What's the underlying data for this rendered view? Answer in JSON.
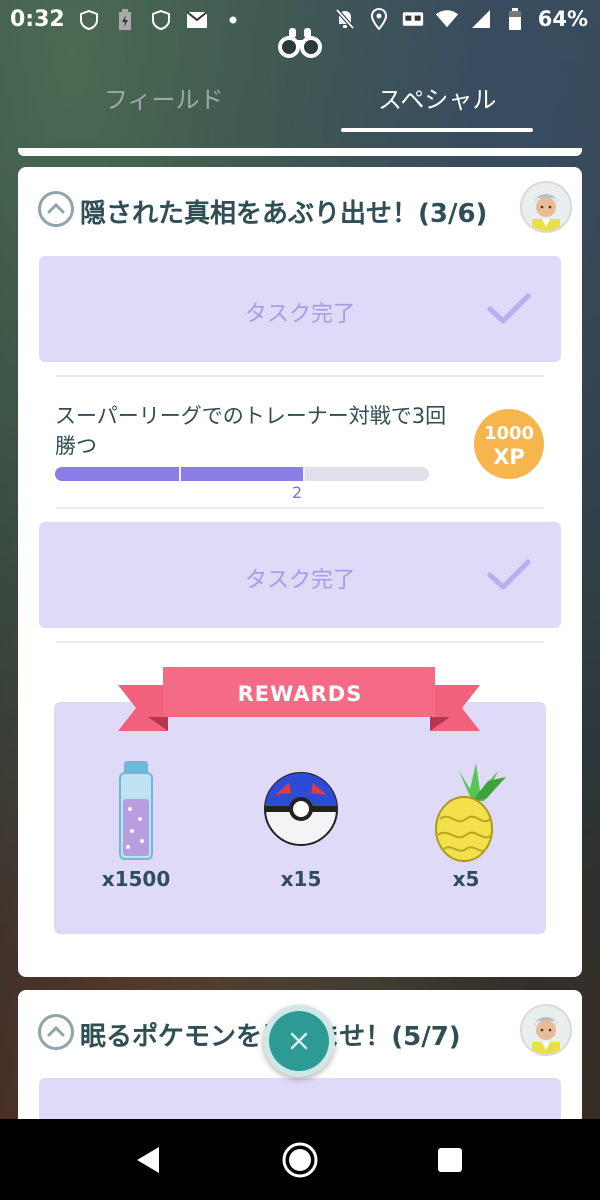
{
  "status_bar": {
    "time": "0:32",
    "battery": "64%"
  },
  "tabs": {
    "field": "フィールド",
    "special": "スペシャル"
  },
  "quest1": {
    "title": "隠された真相をあぶり出せ！(3/6)",
    "task_done_label_1": "タスク完了",
    "task_text": "スーパーリーグでのトレーナー対戦で3回勝つ",
    "progress_count": "2",
    "progress_value": 2,
    "progress_total": 3,
    "xp_amount": "1000",
    "xp_unit": "XP",
    "task_done_label_2": "タスク完了",
    "rewards_title": "REWARDS",
    "rewards": [
      {
        "item": "stardust-vial-icon",
        "qty": "x1500"
      },
      {
        "item": "great-ball-icon",
        "qty": "x15"
      },
      {
        "item": "pinap-berry-icon",
        "qty": "x5"
      }
    ]
  },
  "quest2": {
    "title": "眠るポケモンを目覚ませ！(5/7)"
  },
  "colors": {
    "accent_purple": "#8a7de6",
    "task_bg": "#e0daf9",
    "xp_badge": "#f6b64d",
    "ribbon": "#f2617c",
    "close_button": "#2e9a94"
  }
}
